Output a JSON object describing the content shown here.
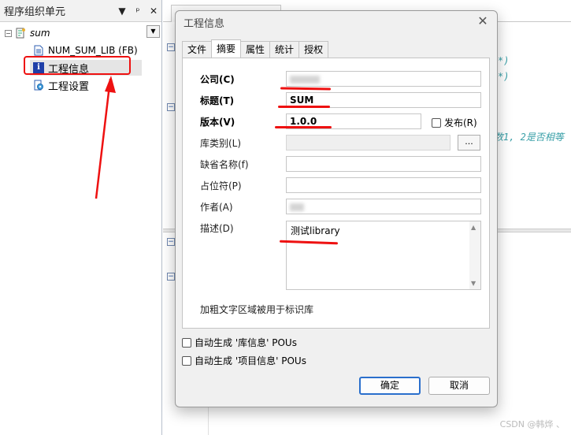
{
  "left_panel": {
    "title": "程序组织单元",
    "buttons": [
      "▼",
      "ᵖ",
      "✕"
    ],
    "tree": {
      "root": "sum",
      "items": [
        {
          "label": "NUM_SUM_LIB (FB)",
          "icon": "document-icon"
        },
        {
          "label": "工程信息",
          "icon": "info-icon",
          "glyph": "i"
        },
        {
          "label": "工程设置",
          "icon": "settings-doc-icon"
        }
      ]
    }
  },
  "editor": {
    "code_fragments": [
      "*)",
      "*)",
      "数1, 2是否相等"
    ]
  },
  "dialog": {
    "title": "工程信息",
    "tabs": [
      "文件",
      "摘要",
      "属性",
      "统计",
      "授权"
    ],
    "active_tab": "摘要",
    "fields": {
      "company": {
        "label": "公司(C)",
        "value": ""
      },
      "title": {
        "label": "标题(T)",
        "value": "SUM"
      },
      "version": {
        "label": "版本(V)",
        "value": "1.0.0"
      },
      "release": {
        "label": "发布(R)",
        "checked": false
      },
      "category": {
        "label": "库类别(L)",
        "value": "",
        "button": "..."
      },
      "default_namespace": {
        "label": "缺省名称(f)",
        "value": ""
      },
      "placeholder": {
        "label": "占位符(P)",
        "value": ""
      },
      "author": {
        "label": "作者(A)",
        "value": ""
      },
      "description": {
        "label": "描述(D)",
        "value": "测试library"
      }
    },
    "note": "加粗文字区域被用于标识库",
    "checkboxes": [
      {
        "label": "自动生成 '库信息' POUs",
        "checked": false
      },
      {
        "label": "自动生成 '项目信息' POUs",
        "checked": false
      }
    ],
    "ok_label": "确定",
    "cancel_label": "取消"
  },
  "watermark": "CSDN @韩烨 、",
  "colors": {
    "annotation": "#e11111",
    "accent": "#2a6fcc"
  }
}
